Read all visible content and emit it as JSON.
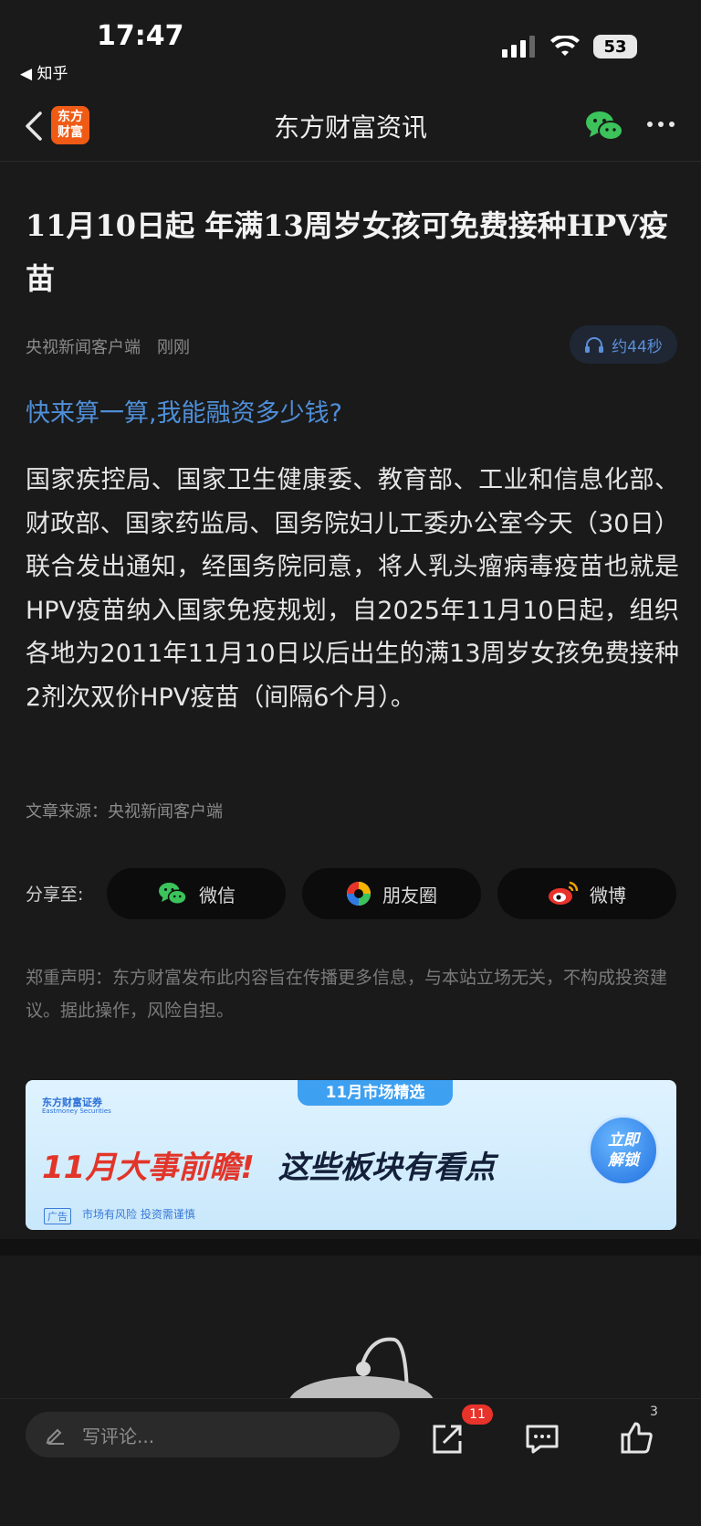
{
  "status_bar": {
    "time": "17:47",
    "back_app": "◀ 知乎",
    "battery": "53",
    "icons": [
      "signal-icon",
      "wifi-icon",
      "battery-icon"
    ]
  },
  "nav": {
    "logo_line1": "东方",
    "logo_line2": "财富",
    "title": "东方财富资讯",
    "icons": [
      "back-icon",
      "wechat-icon",
      "more-icon"
    ]
  },
  "article": {
    "headline": "11月10日起 年满13周岁女孩可免费接种HPV疫苗",
    "source_name": "央视新闻客户端",
    "time": "刚刚",
    "audio_duration": "约44秒",
    "promo_link": "快来算一算,我能融资多少钱?",
    "body": "国家疾控局、国家卫生健康委、教育部、工业和信息化部、财政部、国家药监局、国务院妇儿工委办公室今天（30日）联合发出通知，经国务院同意，将人乳头瘤病毒疫苗也就是HPV疫苗纳入国家免疫规划，自2025年11月10日起，组织各地为2011年11月10日以后出生的满13周岁女孩免费接种2剂次双价HPV疫苗（间隔6个月）。",
    "source_footer": "文章来源：央视新闻客户端"
  },
  "share": {
    "label": "分享至:",
    "buttons": [
      {
        "label": "微信",
        "icon": "wechat-icon"
      },
      {
        "label": "朋友圈",
        "icon": "moments-icon"
      },
      {
        "label": "微博",
        "icon": "weibo-icon"
      }
    ]
  },
  "disclaimer": "郑重声明：东方财富发布此内容旨在传播更多信息，与本站立场无关，不构成投资建议。据此操作，风险自担。",
  "banner": {
    "tab": "11月市场精选",
    "brand": "东方财富证券",
    "brand_en": "Eastmoney Securities",
    "headline_accent": "11月大事前瞻!",
    "headline_rest": "这些板块有看点",
    "cta_line1": "立即",
    "cta_line2": "解锁",
    "ad_tag": "广告",
    "risk": "市场有风险 投资需谨慎"
  },
  "bottom_bar": {
    "comment_placeholder": "写评论...",
    "share_count": "11",
    "like_count": "3",
    "icons": [
      "pencil-icon",
      "share-out-icon",
      "comment-icon",
      "thumbs-up-icon"
    ]
  },
  "colors": {
    "background": "#1a1a1a",
    "link_blue": "#4f8fd8",
    "brand_orange": "#ef5a14",
    "badge_red": "#e8332a"
  }
}
